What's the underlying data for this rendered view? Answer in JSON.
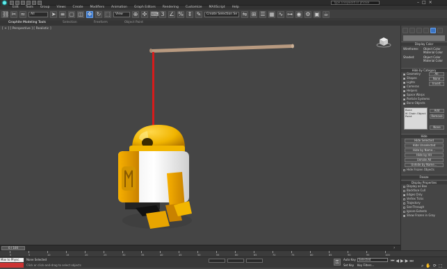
{
  "app": {
    "title": "Autodesk 3ds Max",
    "search_placeholder": "Type a keyword or phrase"
  },
  "quick_access": [
    "new",
    "open",
    "save",
    "undo",
    "redo",
    "workspace"
  ],
  "menubar": [
    "Edit",
    "Tools",
    "Group",
    "Views",
    "Create",
    "Modifiers",
    "Animation",
    "Graph Editors",
    "Rendering",
    "Customize",
    "MAXScript",
    "Help"
  ],
  "toolbar": {
    "selection_filter": "All",
    "ref_coord": "View",
    "named_selection": "Create Selection Se"
  },
  "ribbon": {
    "tabs": [
      "Graphite Modeling Tools",
      "Selection",
      "Freeform",
      "Object Paint"
    ]
  },
  "viewport": {
    "label": "[ + ] [ Perspective ] [ Realistic ]"
  },
  "panel": {
    "display_color": {
      "title": "Display Color",
      "wireframe": "Wireframe:",
      "shaded": "Shaded:",
      "object_color": "Object Color",
      "material_color": "Material Color"
    },
    "hide_by_category": {
      "title": "Hide by Category",
      "items": [
        {
          "label": "Geometry",
          "btn": "All"
        },
        {
          "label": "Shapes",
          "btn": "None"
        },
        {
          "label": "Lights",
          "btn": "Invert"
        },
        {
          "label": "Cameras",
          "btn": ""
        },
        {
          "label": "Helpers",
          "btn": ""
        },
        {
          "label": "Space Warps",
          "btn": ""
        },
        {
          "label": "Particle Systems",
          "btn": ""
        },
        {
          "label": "Bone Objects",
          "btn": ""
        }
      ],
      "list_items": [
        "Bone",
        "IK Chain Object",
        "Point"
      ],
      "add": "Add",
      "remove": "Remove",
      "none": "None"
    },
    "hide": {
      "title": "Hide",
      "buttons": [
        "Hide Selected",
        "Hide Unselected",
        "Hide by Name...",
        "Hide by Hit",
        "Unhide All",
        "Unhide by Name...",
        "Hide Frozen Objects"
      ]
    },
    "freeze": {
      "title": "Freeze"
    },
    "display_properties": {
      "title": "Display Properties",
      "items": [
        "Display as Box",
        "Backface Cull",
        "Edges Only",
        "Vertex Ticks",
        "Trajectory",
        "See-Through",
        "Ignore Extents",
        "Show Frozen in Gray"
      ]
    }
  },
  "timeline": {
    "frame": "0 / 100",
    "ticks": [
      "0",
      "5",
      "10",
      "15",
      "20",
      "25",
      "30",
      "35",
      "40",
      "45",
      "50",
      "55",
      "60",
      "65",
      "70",
      "75",
      "80",
      "85",
      "90",
      "95",
      "100"
    ]
  },
  "status": {
    "maxscript_label": "Max to Physc.",
    "selection": "None Selected",
    "prompt": "Click or click-and-drag to select objects",
    "autokey": "Auto Key",
    "key_mode": "Selected",
    "set_key": "Set Key",
    "key_filters": "Key Filters..."
  }
}
